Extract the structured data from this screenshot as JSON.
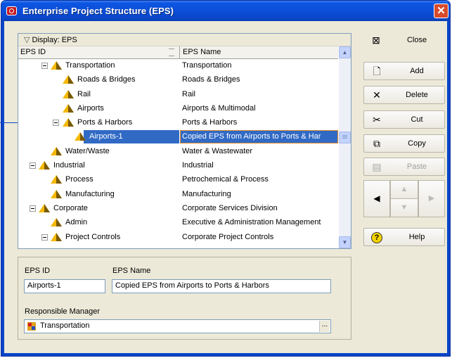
{
  "window": {
    "title": "Enterprise Project Structure (EPS)"
  },
  "display_label": "Display: EPS",
  "columns": {
    "id": "EPS ID",
    "name": "EPS Name"
  },
  "rows": [
    {
      "id": "Transportation",
      "name": "Transportation"
    },
    {
      "id": "Roads & Bridges",
      "name": "Roads & Bridges"
    },
    {
      "id": "Rail",
      "name": "Rail"
    },
    {
      "id": "Airports",
      "name": "Airports & Multimodal"
    },
    {
      "id": "Ports & Harbors",
      "name": "Ports & Harbors"
    },
    {
      "id": "Airports-1",
      "name": "Copied EPS from Airports to Ports & Har"
    },
    {
      "id": "Water/Waste",
      "name": "Water & Wastewater"
    },
    {
      "id": "Industrial",
      "name": "Industrial"
    },
    {
      "id": "Process",
      "name": "Petrochemical & Process"
    },
    {
      "id": "Manufacturing",
      "name": "Manufacturing"
    },
    {
      "id": "Corporate",
      "name": "Corporate Services Division"
    },
    {
      "id": "Admin",
      "name": "Executive & Administration Management"
    },
    {
      "id": "Project Controls",
      "name": "Corporate Project Controls"
    }
  ],
  "buttons": {
    "close": "Close",
    "add": "Add",
    "delete": "Delete",
    "cut": "Cut",
    "copy": "Copy",
    "paste": "Paste",
    "help": "Help"
  },
  "detail": {
    "eps_id_label": "EPS ID",
    "eps_name_label": "EPS Name",
    "eps_id_value": "Airports-1",
    "eps_name_value": "Copied EPS from Airports to Ports & Harbors",
    "manager_label": "Responsible Manager",
    "manager_value": "Transportation",
    "browse": "..."
  },
  "icons": {
    "close": "close-window-icon",
    "add": "new-document-icon",
    "delete": "x-icon",
    "cut": "scissors-icon",
    "copy": "copy-icon",
    "paste": "paste-icon",
    "help": "help-icon"
  },
  "colors": {
    "selection": "#316ac5",
    "titlebar": "#0b4ed8",
    "node_icon": "#f5b800"
  }
}
